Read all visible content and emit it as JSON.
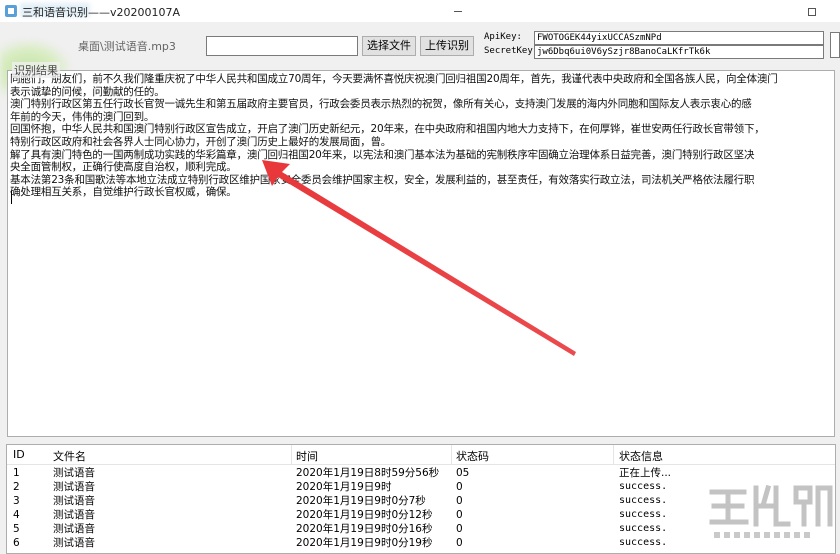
{
  "window": {
    "title": "三和语音识别——v20200107A"
  },
  "toolbar": {
    "file_label": "桌面\\测试语音.mp3",
    "file_value": "",
    "select_button": "选择文件",
    "upload_button": "上传识别",
    "apikey_label": "ApiKey:",
    "apikey_value": "FWOTOGEK44yixUCCASzmNPd",
    "secret_label": "SecretKey:",
    "secret_value": "jw6Dbq6ui0V6ySzjr8BanoCaLKfrTk6k"
  },
  "result": {
    "group_label": "识别结果",
    "lines": [
      "同胞们，朋友们，前不久我们隆重庆祝了中华人民共和国成立70周年，今天要满怀喜悦庆祝澳门回归祖国20周年，首先，我谨代表中央政府和全国各族人民，向全体澳门",
      "表示诚挚的问候，问勤献的任的。",
      "  澳门特别行政区第五任行政长官贺一诚先生和第五届政府主要官员，行政会委员表示热烈的祝贺，像所有关心，支持澳门发展的海内外同胞和国际友人表示衷心的感",
      "年前的今天，伟伟的澳门回到。",
      "  回国怀抱，中华人民共和国澳门特别行政区宣告成立，开启了澳门历史新纪元，20年来，在中央政府和祖国内地大力支持下，在何厚铧，崔世安两任行政长官带领下，",
      "特别行政区政府和社会各界人士同心协力，开创了澳门历史上最好的发展局面，曾。",
      "  解了具有澳门特色的一国两制成功实践的华彩篇章，澳门回归祖国20年来，以宪法和澳门基本法为基础的宪制秩序牢固确立治理体系日益完善，澳门特别行政区坚决",
      "央全面管制权，正确行使高度自治权，顺利完成。",
      "  基本法第23条和国歌法等本地立法成立特别行政区维护国家安全委员会维护国家主权，安全，发展利益的，甚至责任，有效落实行政立法，司法机关严格依法履行职",
      "确处理相互关系，自觉维护行政长官权威，确保。"
    ]
  },
  "table": {
    "headers": [
      "ID",
      "文件名",
      "时间",
      "状态码",
      "状态信息"
    ],
    "rows": [
      {
        "id": "1",
        "name": "测试语音",
        "time": "2020年1月19日8时59分56秒",
        "code": "05",
        "info": "正在上传..."
      },
      {
        "id": "2",
        "name": "测试语音",
        "time": "2020年1月19日9时",
        "code": "0",
        "info": "success."
      },
      {
        "id": "3",
        "name": "测试语音",
        "time": "2020年1月19日9时0分7秒",
        "code": "0",
        "info": "success."
      },
      {
        "id": "4",
        "name": "测试语音",
        "time": "2020年1月19日9时0分12秒",
        "code": "0",
        "info": "success."
      },
      {
        "id": "5",
        "name": "测试语音",
        "time": "2020年1月19日9时0分16秒",
        "code": "0",
        "info": "success."
      },
      {
        "id": "6",
        "name": "测试语音",
        "time": "2020年1月19日9时0分19秒",
        "code": "0",
        "info": "success."
      }
    ]
  },
  "annotation": {
    "arrow_color": "#e8373a"
  },
  "icons": {
    "app": "app-icon",
    "minimize": "minimize-icon",
    "maximize": "maximize-icon",
    "watermark": "watermark-logo"
  }
}
